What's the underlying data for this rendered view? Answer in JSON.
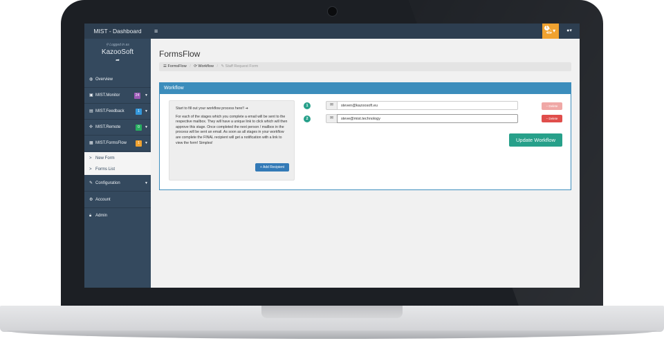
{
  "topbar": {
    "brand": "MIST - Dashboard",
    "notification_count": "1"
  },
  "sidebar": {
    "logged_in_label": "Logged in as",
    "org_name": "KazooSoft",
    "items": [
      {
        "label": "Overview",
        "icon": "dashboard-icon",
        "glyph": "◍"
      },
      {
        "label": "MIST.Monitor",
        "icon": "monitor-icon",
        "glyph": "▣",
        "badge": "24",
        "badge_color": "#9b59b6"
      },
      {
        "label": "MIST.Feedback",
        "icon": "feedback-icon",
        "glyph": "▤",
        "badge": "1",
        "badge_color": "#3498db"
      },
      {
        "label": "MIST.Remote",
        "icon": "users-icon",
        "glyph": "✣",
        "badge": "0",
        "badge_color": "#27ae60"
      },
      {
        "label": "MIST.FormsFlow",
        "icon": "forms-icon",
        "glyph": "▦",
        "badge": "1",
        "badge_color": "#f0a230"
      }
    ],
    "submenu": [
      "New Form",
      "Forms List"
    ],
    "configuration": "Configuration",
    "account": "Account",
    "admin": "Admin"
  },
  "main": {
    "title": "FormsFlow",
    "breadcrumb": [
      "FormsFlow",
      "Workflow",
      "Staff Request Form"
    ],
    "panel_title": "Workflow",
    "info_title": "Start to fill out your workflow process here!! ➔",
    "info_text": "For each of the stages which you complete a email will be sent to the respective mailbox. They will have a unique link to click which will then approve this stage. Once completed the next person / mailbox in the process will be sent an email. As soon as all stages in your workflow are complete the FINAL recipient will get a notification with a link to view the form! Simples!",
    "add_recipient": "+ Add Recipient",
    "recipients": [
      {
        "number": "1",
        "email": "steven@kazoosoft.eu",
        "delete_label": "− Delete"
      },
      {
        "number": "2",
        "email": "steve@mist.technology",
        "delete_label": "− Delete"
      }
    ],
    "update_button": "Update Workflow"
  }
}
